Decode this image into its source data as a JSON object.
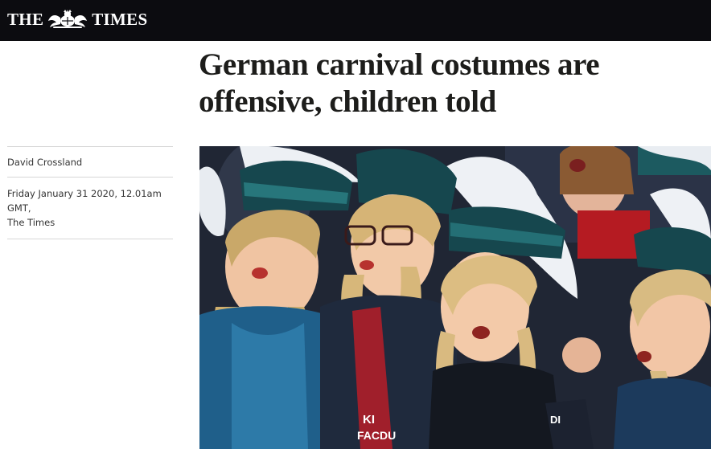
{
  "masthead": {
    "logo_left": "THE",
    "logo_right": "TIMES",
    "logo_icon": "royal-crest-icon",
    "background": "#0c0c10"
  },
  "article": {
    "headline": "German carnival costumes are offensive, children told",
    "author": "David Crossland",
    "date": "Friday January 31 2020, 12.01am GMT,",
    "publication": "The Times"
  },
  "image": {
    "banner_text_1": "KI",
    "banner_text_2": "FACDU",
    "shirt_text": "DI"
  }
}
